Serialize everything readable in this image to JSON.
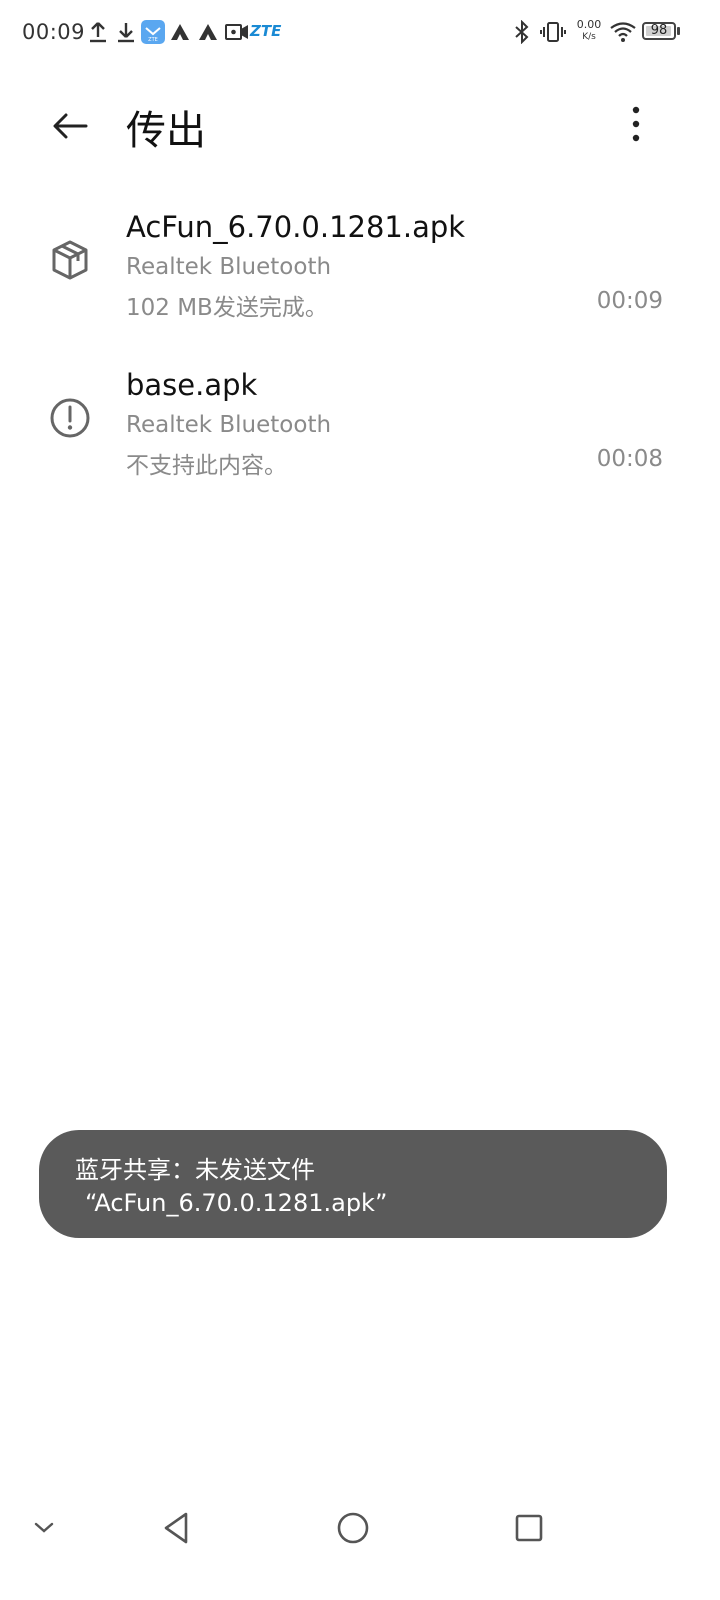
{
  "status_bar": {
    "time": "00:09",
    "brand": "ZTE",
    "net_speed_value": "0.00",
    "net_speed_unit": "K/s",
    "battery_level": "98",
    "battery_fraction": 0.98,
    "icons": [
      "upload-icon",
      "download-icon",
      "app-icon",
      "font-a-icon",
      "font-a-icon",
      "video-icon",
      "bluetooth-icon",
      "vibrate-icon",
      "wifi-icon",
      "battery-icon"
    ]
  },
  "app_bar": {
    "title": "传出",
    "back_icon": "arrow-left-icon",
    "more_icon": "more-vert-icon"
  },
  "transfers": [
    {
      "icon": "package-icon",
      "name": "AcFun_6.70.0.1281.apk",
      "device": "Realtek Bluetooth",
      "status": "102 MB发送完成。",
      "time": "00:09"
    },
    {
      "icon": "alert-circle-icon",
      "name": "base.apk",
      "device": "Realtek Bluetooth",
      "status": "不支持此内容。",
      "time": "00:08"
    }
  ],
  "toast": {
    "line1": "蓝牙共享：未发送文件",
    "line2": "“AcFun_6.70.0.1281.apk”"
  },
  "nav_bar": {
    "icons": [
      "chevron-down-icon",
      "back-triangle-icon",
      "home-circle-icon",
      "recents-square-icon"
    ]
  },
  "colors": {
    "background": "#ffffff",
    "secondary_text": "#8a8a8a",
    "toast_bg": "#5a5a5a",
    "app_icon_blue": "#5aa7f0",
    "brand_blue": "#1a8ad4"
  }
}
